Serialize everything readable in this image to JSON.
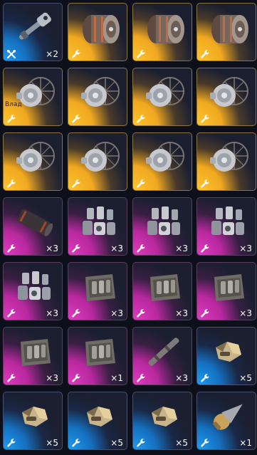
{
  "inventory": {
    "rows": [
      [
        {
          "item": "scope-rifle-part",
          "rarity": "blue",
          "icon": "crossed-tools-icon",
          "qty": "×2"
        },
        {
          "item": "engine-drum",
          "rarity": "gold",
          "icon": "wrench-icon",
          "qty": ""
        },
        {
          "item": "engine-drum",
          "rarity": "gold",
          "icon": "wrench-icon",
          "qty": ""
        },
        {
          "item": "engine-drum",
          "rarity": "gold",
          "icon": "wrench-icon",
          "qty": ""
        }
      ],
      [
        {
          "item": "turbine-engine",
          "rarity": "gold",
          "icon": "wrench-icon",
          "qty": "",
          "tag": "Влад"
        },
        {
          "item": "turbine-engine",
          "rarity": "gold",
          "icon": "wrench-icon",
          "qty": ""
        },
        {
          "item": "turbine-engine",
          "rarity": "gold",
          "icon": "wrench-icon",
          "qty": ""
        },
        {
          "item": "turbine-engine",
          "rarity": "gold",
          "icon": "wrench-icon",
          "qty": ""
        }
      ],
      [
        {
          "item": "turbine-engine",
          "rarity": "gold",
          "icon": "wrench-icon",
          "qty": ""
        },
        {
          "item": "turbine-engine",
          "rarity": "gold",
          "icon": "wrench-icon",
          "qty": ""
        },
        {
          "item": "turbine-engine",
          "rarity": "gold",
          "icon": "wrench-icon",
          "qty": ""
        },
        {
          "item": "turbine-engine",
          "rarity": "gold",
          "icon": "wrench-icon",
          "qty": ""
        }
      ],
      [
        {
          "item": "dark-barrel",
          "rarity": "pink",
          "icon": "wrench-icon",
          "qty": "×3"
        },
        {
          "item": "engine-parts-pile",
          "rarity": "pink",
          "icon": "wrench-icon",
          "qty": "×3"
        },
        {
          "item": "engine-parts-pile",
          "rarity": "pink",
          "icon": "wrench-icon",
          "qty": "×3"
        },
        {
          "item": "engine-parts-pile",
          "rarity": "pink",
          "icon": "wrench-icon",
          "qty": "×3"
        }
      ],
      [
        {
          "item": "engine-parts-pile",
          "rarity": "pink",
          "icon": "wrench-icon",
          "qty": "×3"
        },
        {
          "item": "parts-crate",
          "rarity": "pink",
          "icon": "wrench-icon",
          "qty": "×3"
        },
        {
          "item": "parts-crate",
          "rarity": "pink",
          "icon": "wrench-icon",
          "qty": "×3"
        },
        {
          "item": "parts-crate",
          "rarity": "pink",
          "icon": "wrench-icon",
          "qty": "×3"
        }
      ],
      [
        {
          "item": "parts-crate",
          "rarity": "pink",
          "icon": "wrench-icon",
          "qty": "×3"
        },
        {
          "item": "parts-crate",
          "rarity": "pink",
          "icon": "wrench-icon",
          "qty": "×1"
        },
        {
          "item": "metal-rod",
          "rarity": "pink",
          "icon": "wrench-icon",
          "qty": "×3"
        },
        {
          "item": "gold-nozzle",
          "rarity": "blue",
          "icon": "wrench-icon",
          "qty": "×5"
        }
      ],
      [
        {
          "item": "gold-nozzle",
          "rarity": "blue",
          "icon": "wrench-icon",
          "qty": "×5"
        },
        {
          "item": "gold-nozzle",
          "rarity": "blue",
          "icon": "wrench-icon",
          "qty": "×5"
        },
        {
          "item": "gold-nozzle",
          "rarity": "blue",
          "icon": "wrench-icon",
          "qty": "×5"
        },
        {
          "item": "warhead-cone",
          "rarity": "blue",
          "icon": "wrench-icon",
          "qty": "×1"
        }
      ]
    ]
  }
}
